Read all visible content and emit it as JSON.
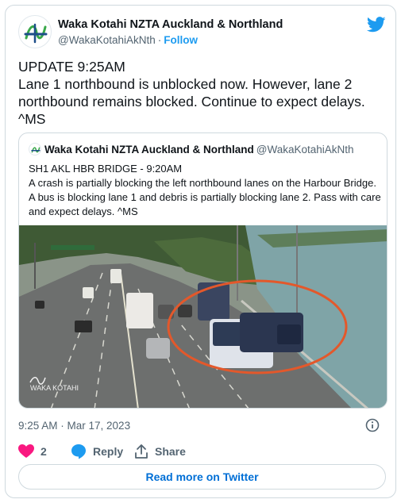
{
  "author": {
    "name": "Waka Kotahi NZTA Auckland & Northland",
    "handle": "@WakaKotahiAkNth",
    "separator": "·",
    "follow_label": "Follow"
  },
  "brand_icon": "twitter-bird-icon",
  "tweet": {
    "text": "UPDATE 9:25AM\nLane 1 northbound is unblocked now. However, lane 2 northbound remains blocked. Continue to expect delays. ^MS"
  },
  "quoted": {
    "name": "Waka Kotahi NZTA Auckland & Northland",
    "handle": "@WakaKotahiAkNth",
    "text": "SH1 AKL HBR BRIDGE - 9:20AM\nA crash is partially blocking the left northbound lanes on the Harbour Bridge. A bus is blocking lane 1 and debris is partially blocking lane 2. Pass with care and expect delays. ^MS",
    "image_watermark": "WAKA KOTAHI"
  },
  "meta": {
    "timestamp": "9:25 AM · Mar 17, 2023"
  },
  "actions": {
    "like_count": "2",
    "reply_label": "Reply",
    "share_label": "Share"
  },
  "read_more_label": "Read more on Twitter",
  "colors": {
    "accent": "#1d9bf0",
    "like": "#f91880",
    "link": "#006fd6",
    "border": "#cfd9de",
    "annotation": "#e3582b"
  }
}
